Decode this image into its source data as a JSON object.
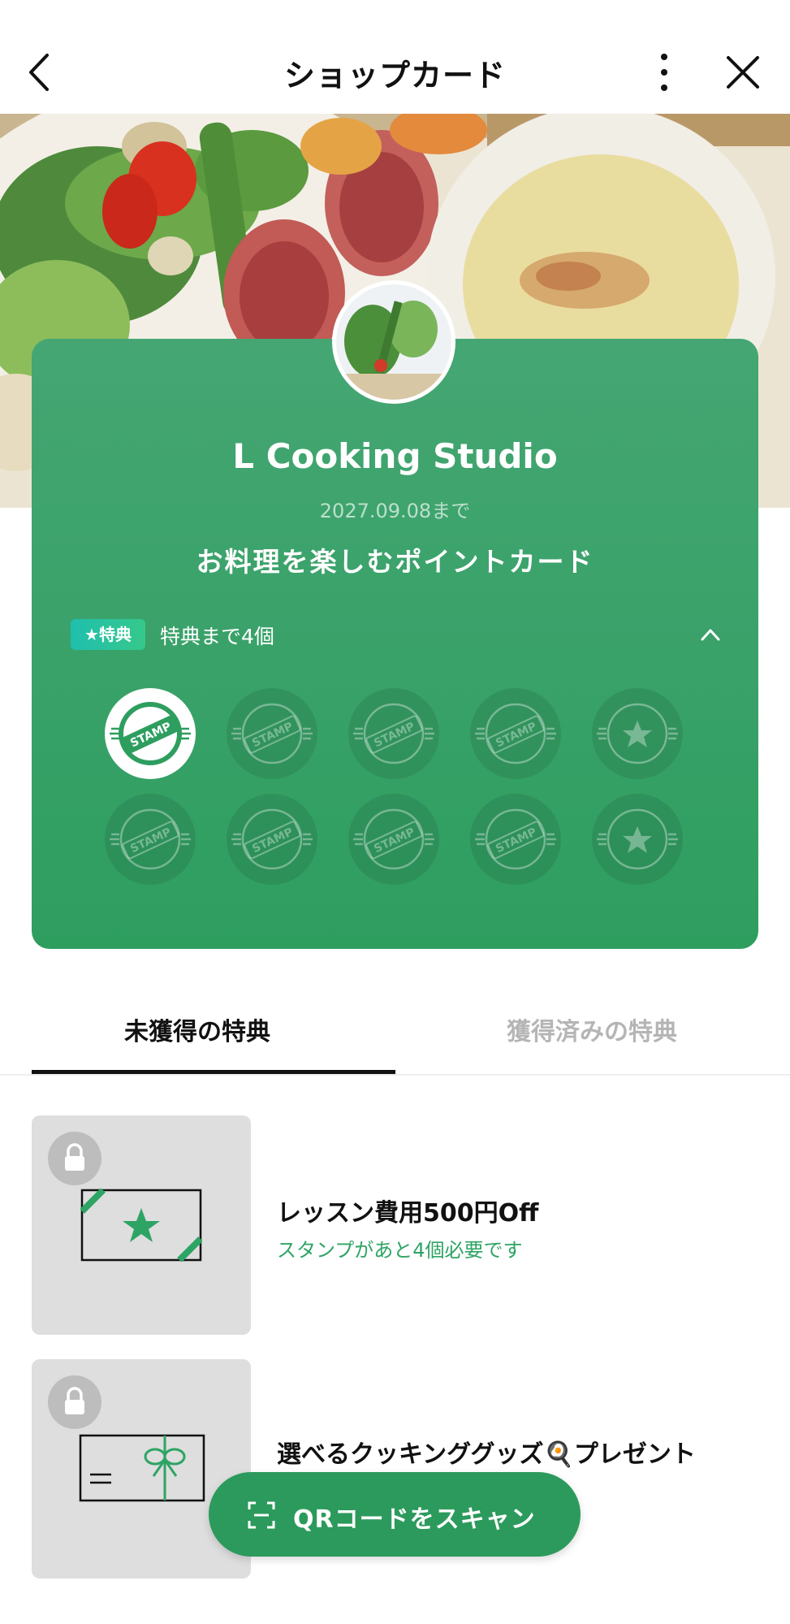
{
  "header": {
    "title": "ショップカード",
    "back_icon": "chevron-left-icon",
    "more_icon": "more-vertical-icon",
    "close_icon": "close-icon"
  },
  "shop": {
    "name": "L Cooking Studio",
    "expiry": "2027.09.08まで",
    "card_title": "お料理を楽しむポイントカード",
    "reward_badge": "★特典",
    "reward_progress": "特典まで4個",
    "stamps_total": 10,
    "stamps_collected": 1,
    "stamp_label": "STAMP"
  },
  "tabs": [
    {
      "label": "未獲得の特典",
      "active": true
    },
    {
      "label": "獲得済みの特典",
      "active": false
    }
  ],
  "rewards": [
    {
      "title": "レッスン費用500円Off",
      "subtitle": "スタンプがあと4個必要です",
      "icon": "coupon-star-icon",
      "locked": true
    },
    {
      "title": "選べるクッキンググッズ🍳プレゼント",
      "subtitle": "",
      "icon": "gift-card-icon",
      "locked": true
    }
  ],
  "qr_button": {
    "label": "QRコードをスキャン",
    "icon": "qr-scan-icon"
  },
  "colors": {
    "card_green": "#3ea36b",
    "accent_green": "#2ea464",
    "button_green": "#2c9a5c",
    "inactive_tab": "#b5b5b5"
  }
}
